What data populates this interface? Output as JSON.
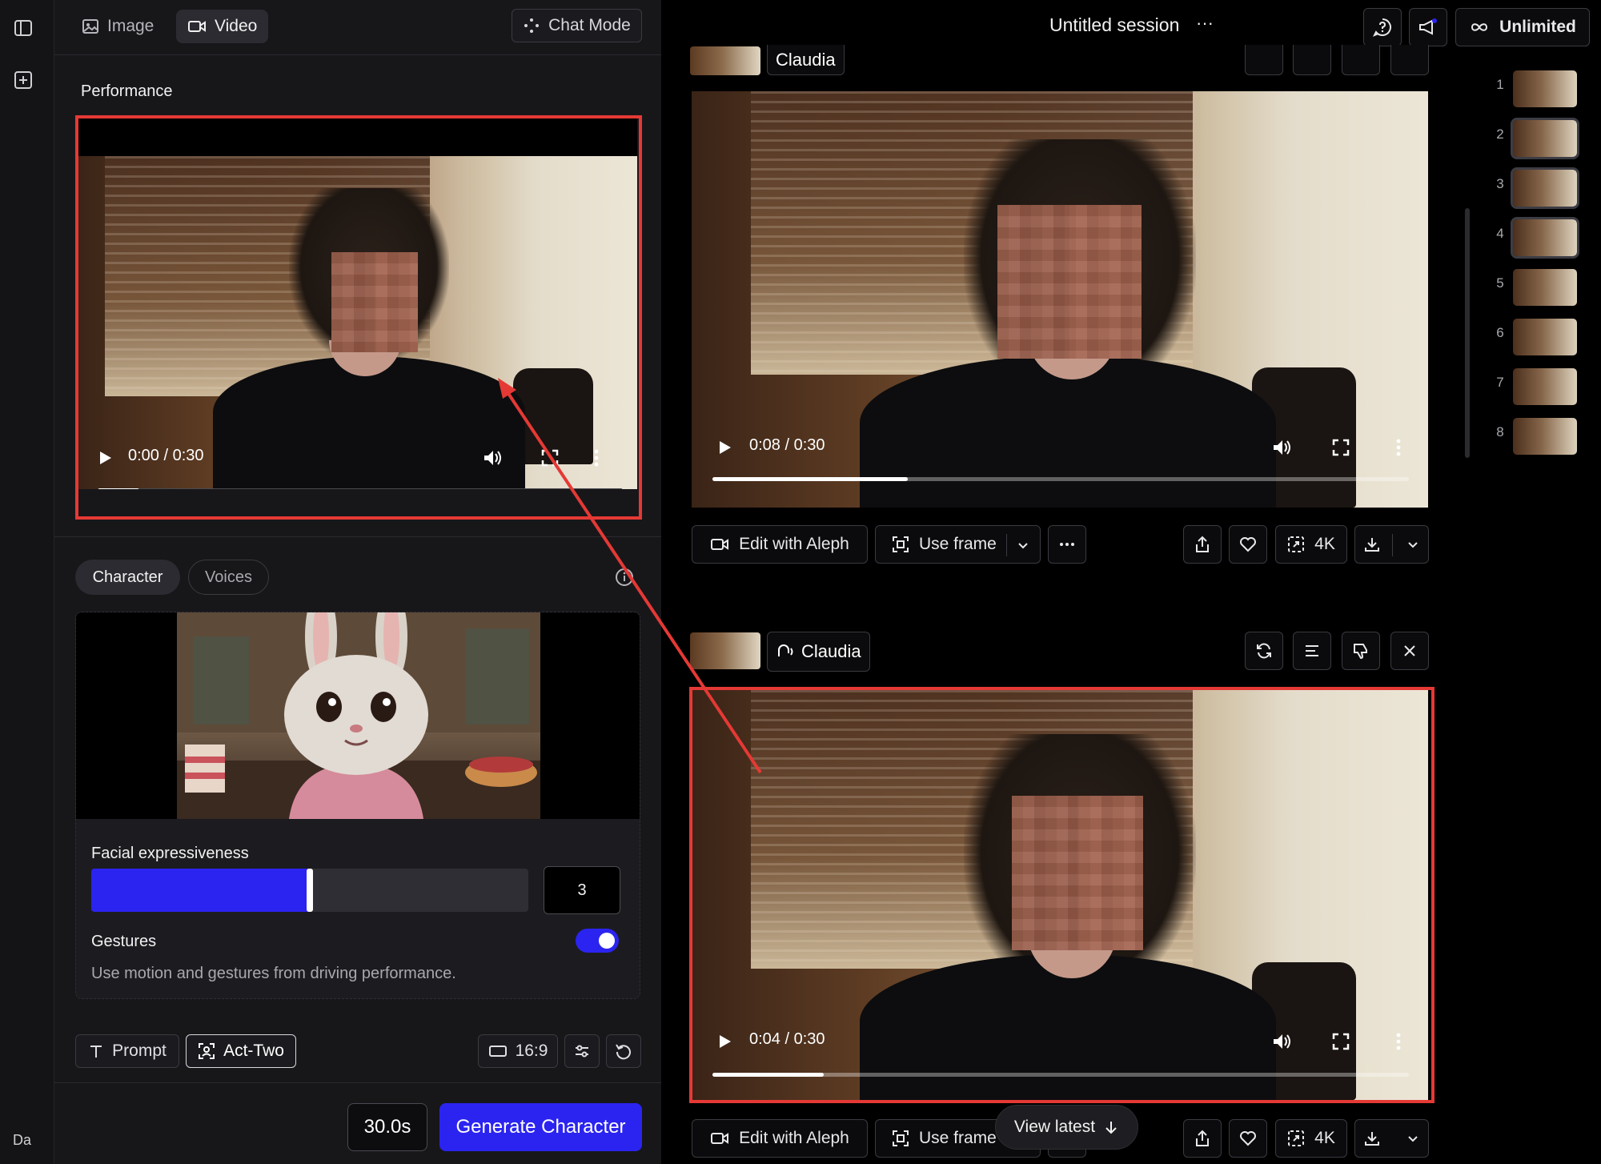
{
  "left_nav": {
    "user_initials": "Da"
  },
  "left_panel": {
    "tabs": [
      {
        "label": "Image",
        "icon": "image-icon",
        "active": false
      },
      {
        "label": "Video",
        "icon": "video-camera-icon",
        "active": true
      }
    ],
    "chat_mode_label": "Chat Mode",
    "performance": {
      "label": "Performance",
      "video": {
        "time_current": "0:00",
        "time_total": "0:30",
        "time_display": "0:00 / 0:30",
        "progress": 0.08
      }
    },
    "character_tabs": [
      {
        "label": "Character",
        "active": true
      },
      {
        "label": "Voices",
        "active": false
      }
    ],
    "settings": {
      "facial_expressiveness_label": "Facial expressiveness",
      "facial_expressiveness_value": "3",
      "facial_expressiveness_fraction": 0.5,
      "gestures_label": "Gestures",
      "gestures_enabled": true,
      "gestures_description": "Use motion and gestures from driving performance."
    },
    "toolbar": {
      "prompt_label": "Prompt",
      "act_two_label": "Act-Two",
      "aspect_ratio": "16:9"
    },
    "duration": "30.0s",
    "generate_label": "Generate Character"
  },
  "header": {
    "session_title": "Untitled session",
    "more_label": "···",
    "plan_label": "Unlimited"
  },
  "generations": [
    {
      "voice_name": "Claudia",
      "video": {
        "time_display": "0:08 / 0:30",
        "progress": 0.28
      },
      "actions": {
        "edit_label": "Edit with Aleph",
        "use_frame_label": "Use frame",
        "upscale_label": "4K"
      }
    },
    {
      "voice_name": "Claudia",
      "video": {
        "time_display": "0:04 / 0:30",
        "progress": 0.16
      },
      "actions": {
        "edit_label": "Edit with Aleph",
        "use_frame_label": "Use frame",
        "upscale_label": "4K"
      }
    }
  ],
  "view_latest_label": "View latest",
  "history": [
    "1",
    "2",
    "3",
    "4",
    "5",
    "6",
    "7",
    "8"
  ],
  "colors": {
    "accent": "#2b24f0",
    "annotation": "#e53935",
    "panel": "#17171a"
  }
}
